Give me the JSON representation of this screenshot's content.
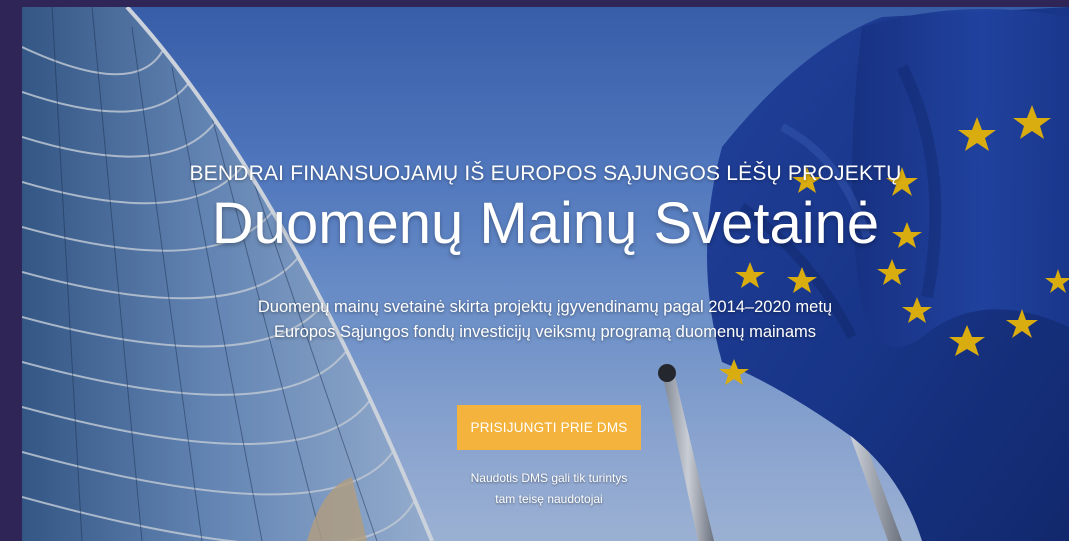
{
  "hero": {
    "kicker": "BENDRAI FINANSUOJAMŲ IŠ EUROPOS SĄJUNGOS LĖŠŲ PROJEKTŲ",
    "title": "Duomenų Mainų Svetainė",
    "description": "Duomenų mainų svetainė skirta projektų įgyvendinamų pagal 2014–2020 metų Europos Sąjungos fondų investicijų veiksmų programą duomenų mainams",
    "login_button_label": "PRISIJUNGTI PRIE DMS",
    "note_line1": "Naudotis DMS gali tik turintys",
    "note_line2": "tam teisę naudotojai"
  },
  "colors": {
    "frame_background": "#2f2657",
    "sky": "#5a84cf",
    "button_background": "#f3b33d",
    "eu_flag_blue": "#1f3d9a",
    "eu_star_yellow": "#f6c10a"
  }
}
